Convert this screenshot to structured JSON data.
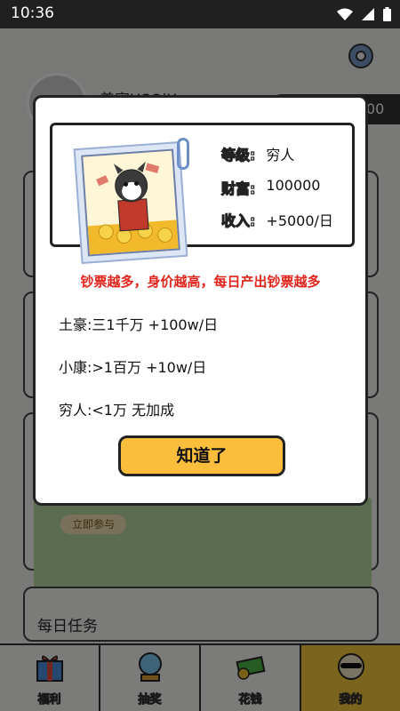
{
  "status_bar": {
    "time": "10:36",
    "icons": [
      "wifi-icon",
      "signal-icon",
      "battery-icon"
    ]
  },
  "background": {
    "username": "养家USOiX",
    "wealth_value": "00",
    "join_label": "立即参与",
    "daily_task_label": "每日任务"
  },
  "modal": {
    "stats": [
      {
        "key": "等级:",
        "value": "穷人"
      },
      {
        "key": "财富:",
        "value": "100000"
      },
      {
        "key": "收入:",
        "value": "+5000/日"
      }
    ],
    "headline": "钞票越多，身价越高，每日产出钞票越多",
    "tiers": [
      "土豪:三1千万 +100w/日",
      "小康:>1百万 +10w/日",
      "穷人:<1万 无加成"
    ],
    "ok_button_label": "知道了"
  },
  "tabs": [
    {
      "label": "福利",
      "icon": "gift-icon"
    },
    {
      "label": "抽奖",
      "icon": "crystal-ball-icon"
    },
    {
      "label": "花钱",
      "icon": "money-icon"
    },
    {
      "label": "我的",
      "icon": "dog-sunglasses-icon"
    }
  ],
  "colors": {
    "accent_yellow": "#fbbd3c",
    "headline_red": "#e0231b",
    "tab_active": "#f7c93a"
  }
}
